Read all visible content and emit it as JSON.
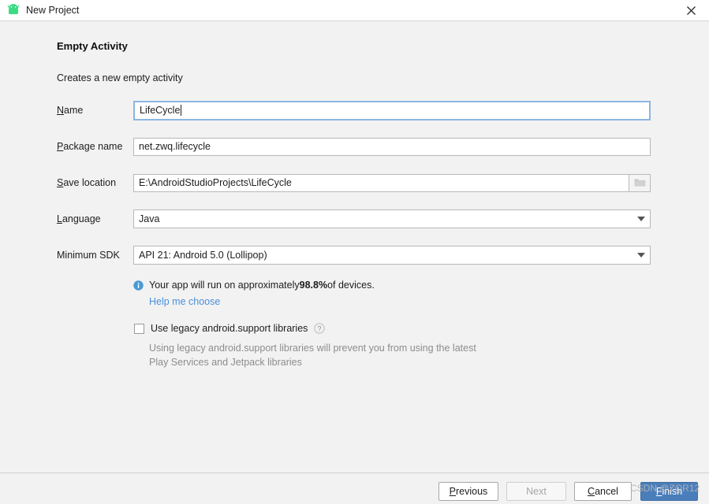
{
  "window": {
    "title": "New Project",
    "icon": "android-robot-icon",
    "close_label": "✕",
    "accent_color": "#4a7ebb",
    "background_color": "#f2f2f2"
  },
  "page": {
    "heading": "Empty Activity",
    "subheading": "Creates a new empty activity"
  },
  "fields": {
    "name": {
      "label_mnemonic": "N",
      "label_rest": "ame",
      "value": "LifeCycle",
      "focused": true
    },
    "package_name": {
      "label_mnemonic": "P",
      "label_rest": "ackage name",
      "value": "net.zwq.lifecycle"
    },
    "save_location": {
      "label_mnemonic": "S",
      "label_rest": "ave location",
      "value": "E:\\AndroidStudioProjects\\LifeCycle",
      "browse_icon": "folder-icon"
    },
    "language": {
      "label_mnemonic": "L",
      "label_rest": "anguage",
      "value": "Java",
      "dropdown_icon": "chevron-down-icon"
    },
    "minimum_sdk": {
      "label_mnemonic": "",
      "label_rest": "Minimum SDK",
      "value": "API 21: Android 5.0 (Lollipop)",
      "dropdown_icon": "chevron-down-icon"
    }
  },
  "info": {
    "icon": "info-icon",
    "text_before": "Your app will run on approximately ",
    "percentage": "98.8%",
    "text_after": " of devices.",
    "link": "Help me choose",
    "link_color": "#4a90d9"
  },
  "legacy": {
    "checkbox_label": "Use legacy android.support libraries",
    "checked": false,
    "help_icon": "question-mark-icon",
    "hint": "Using legacy android.support libraries will prevent you from using the latest Play Services and Jetpack libraries"
  },
  "footer": {
    "previous_mnemonic": "P",
    "previous_rest": "revious",
    "next_label": "Next",
    "next_enabled": false,
    "cancel_mnemonic": "C",
    "cancel_rest": "ancel",
    "finish_mnemonic": "F",
    "finish_rest": "inish"
  },
  "watermark": {
    "text": "CSDN @ZQR12"
  }
}
